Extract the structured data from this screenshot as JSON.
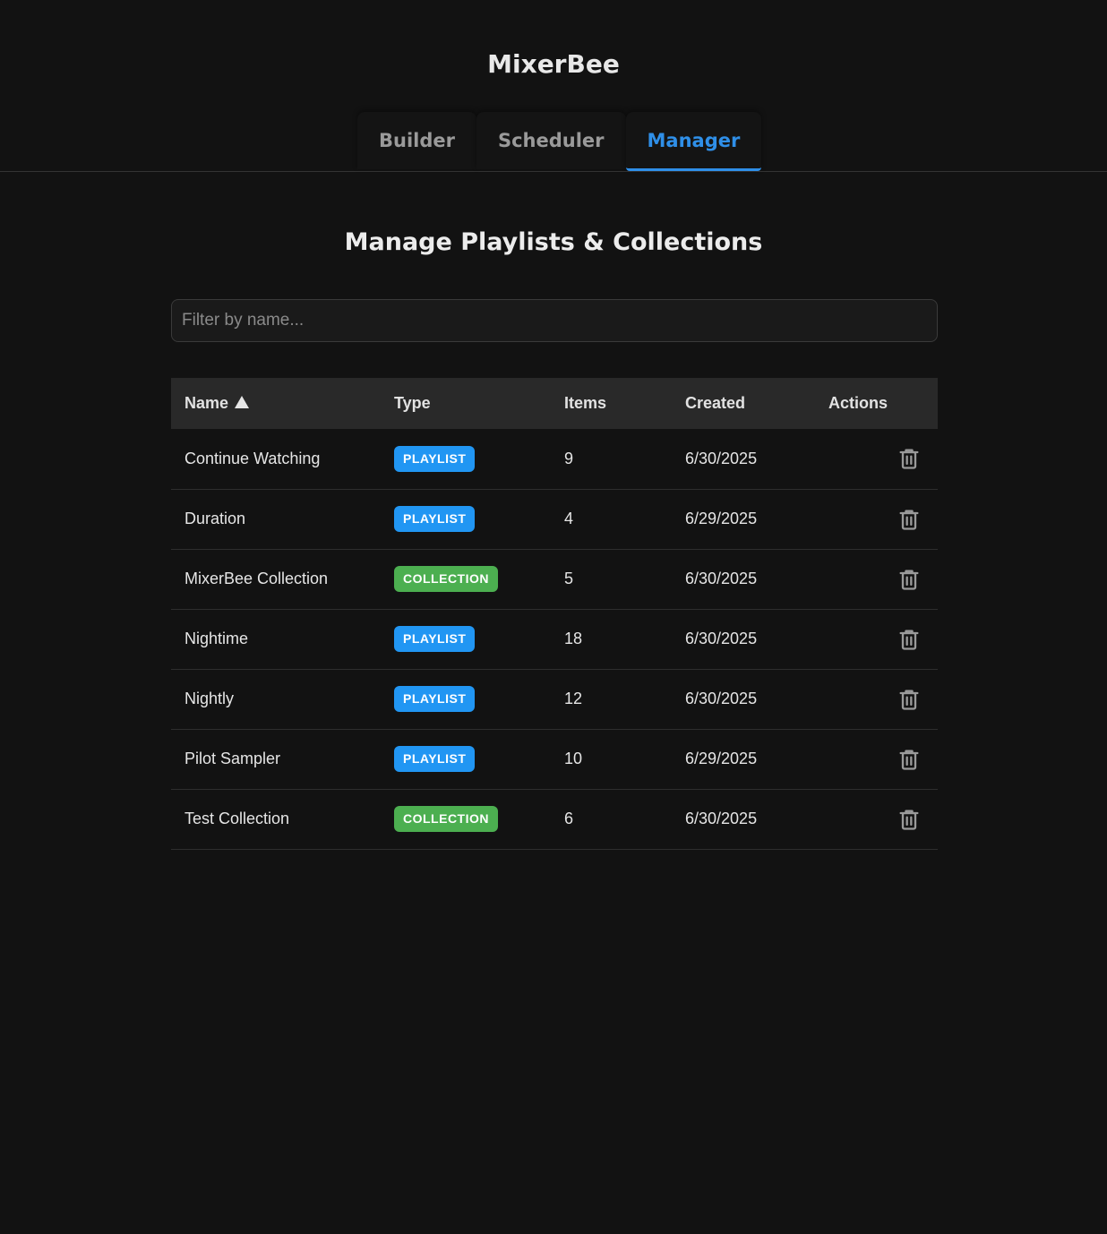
{
  "app": {
    "title": "MixerBee"
  },
  "tabs": [
    {
      "label": "Builder",
      "active": false
    },
    {
      "label": "Scheduler",
      "active": false
    },
    {
      "label": "Manager",
      "active": true
    }
  ],
  "main": {
    "title": "Manage Playlists & Collections",
    "filter": {
      "placeholder": "Filter by name...",
      "value": ""
    }
  },
  "table": {
    "headers": {
      "name": "Name",
      "type": "Type",
      "items": "Items",
      "created": "Created",
      "actions": "Actions"
    },
    "sort": {
      "column": "Name",
      "direction": "ascending"
    },
    "rows": [
      {
        "name": "Continue Watching",
        "type": "PLAYLIST",
        "items": "9",
        "created": "6/30/2025"
      },
      {
        "name": "Duration",
        "type": "PLAYLIST",
        "items": "4",
        "created": "6/29/2025"
      },
      {
        "name": "MixerBee Collection",
        "type": "COLLECTION",
        "items": "5",
        "created": "6/30/2025"
      },
      {
        "name": "Nightime",
        "type": "PLAYLIST",
        "items": "18",
        "created": "6/30/2025"
      },
      {
        "name": "Nightly",
        "type": "PLAYLIST",
        "items": "12",
        "created": "6/30/2025"
      },
      {
        "name": "Pilot Sampler",
        "type": "PLAYLIST",
        "items": "10",
        "created": "6/29/2025"
      },
      {
        "name": "Test Collection",
        "type": "COLLECTION",
        "items": "6",
        "created": "6/30/2025"
      }
    ],
    "row_action_icon": "trash-icon"
  },
  "colors": {
    "background": "#121212",
    "accent": "#2f8fe8",
    "playlist_badge": "#2196f3",
    "collection_badge": "#4caf50"
  }
}
